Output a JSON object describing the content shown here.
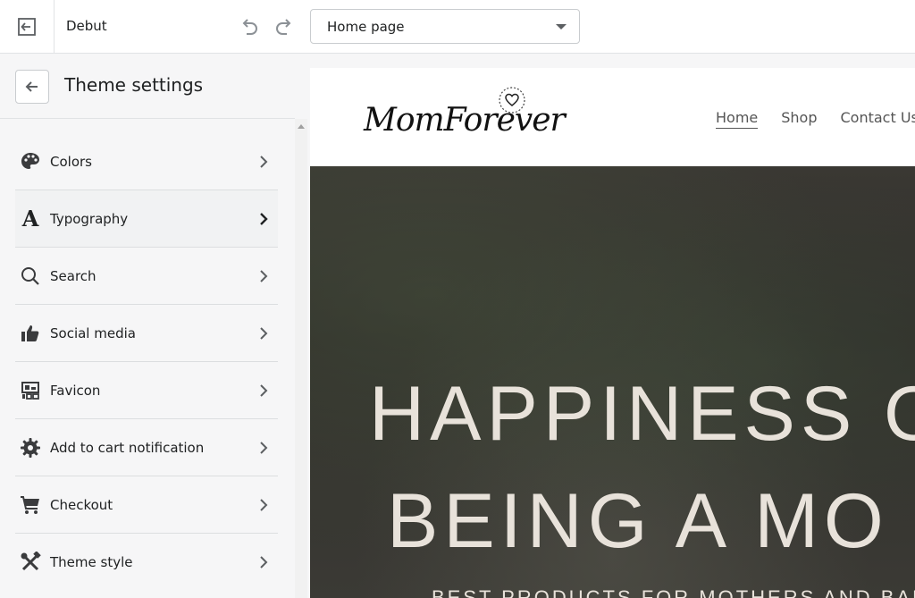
{
  "topbar": {
    "theme_name": "Debut",
    "page_select": {
      "selected": "Home page"
    }
  },
  "sidebar": {
    "title": "Theme settings",
    "items": [
      {
        "label": "Colors",
        "icon": "palette-icon"
      },
      {
        "label": "Typography",
        "icon": "typography-icon"
      },
      {
        "label": "Search",
        "icon": "search-icon"
      },
      {
        "label": "Social media",
        "icon": "thumbs-up-icon"
      },
      {
        "label": "Favicon",
        "icon": "favicon-icon"
      },
      {
        "label": "Add to cart notification",
        "icon": "gear-icon"
      },
      {
        "label": "Checkout",
        "icon": "cart-icon"
      },
      {
        "label": "Theme style",
        "icon": "tools-icon"
      }
    ],
    "active_index": 1
  },
  "preview": {
    "logo_text": "MomForever",
    "nav": [
      "Home",
      "Shop",
      "Contact Us"
    ],
    "hero": {
      "line1": "HAPPINESS O",
      "line2": "BEING A MO",
      "subtitle": "BEST PRODUCTS FOR MOTHERS AND BABIES"
    }
  },
  "colors": {
    "text": "#202223",
    "border": "#c9cccf",
    "sidebar_bg": "#f6f6f7",
    "hero_text": "#e8e2da"
  }
}
